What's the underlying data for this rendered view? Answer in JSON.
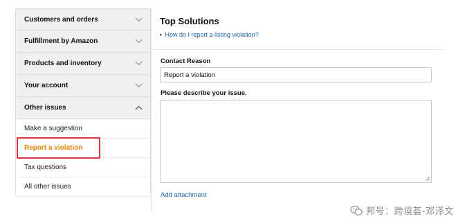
{
  "sidebar": {
    "categories": [
      {
        "label": "Customers and orders",
        "expanded": false
      },
      {
        "label": "Fulfillment by Amazon",
        "expanded": false
      },
      {
        "label": "Products and inventory",
        "expanded": false
      },
      {
        "label": "Your account",
        "expanded": false
      },
      {
        "label": "Other issues",
        "expanded": true
      }
    ],
    "subitems": [
      {
        "label": "Make a suggestion",
        "active": false
      },
      {
        "label": "Report a violation",
        "active": true
      },
      {
        "label": "Tax questions",
        "active": false
      },
      {
        "label": "All other issues",
        "active": false
      }
    ]
  },
  "main": {
    "top_title": "Top Solutions",
    "faq_link": "How do I report a listing violation?",
    "contact_reason_label": "Contact Reason",
    "contact_reason_value": "Report a violation",
    "describe_label": "Please describe your issue.",
    "describe_value": "",
    "attachment_link": "Add attachment"
  },
  "watermark": {
    "text": "邦号：跨境荟-邓泽文"
  },
  "colors": {
    "active_item": "#e3860d",
    "highlight_border": "#d9363e",
    "link": "#1a63a8",
    "category_bg": "#f0f0f0"
  }
}
